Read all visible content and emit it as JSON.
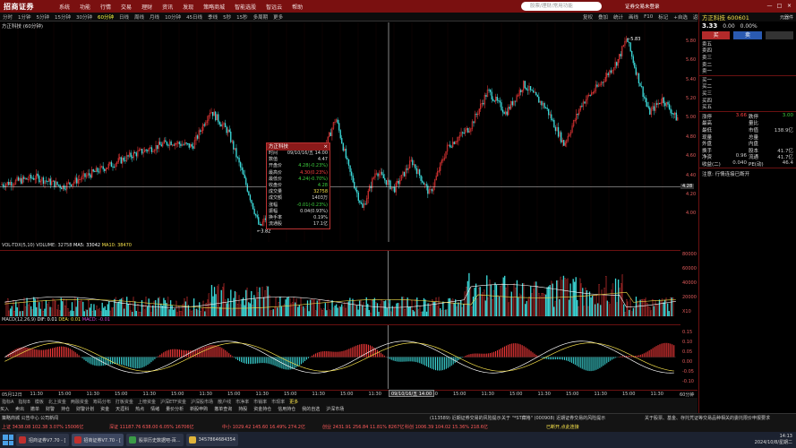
{
  "top": {
    "logo": "招商证券",
    "menu": [
      "系统",
      "功能",
      "行情",
      "交易",
      "理财",
      "资讯",
      "发现",
      "策略商城",
      "智能选股",
      "智远云",
      "帮助"
    ],
    "search_placeholder": "股票/理财/常用功能",
    "login_label": "证券交易未登录",
    "win_min": "—",
    "win_max": "□",
    "win_close": "×"
  },
  "periods": [
    "分时",
    "1分钟",
    "5分钟",
    "15分钟",
    "30分钟",
    "60分钟",
    "日线",
    "周线",
    "月线",
    "10分钟",
    "45日线",
    "季线",
    "5秒",
    "15秒",
    "多周期",
    "更多"
  ],
  "active_period": "60分钟",
  "right_tools": [
    "复权",
    "叠加",
    "统计",
    "画线",
    "F10",
    "标记",
    "+自选",
    "返回"
  ],
  "chart_title": "方正科技 (60分钟)",
  "price_axis": [
    "5.80",
    "5.60",
    "5.40",
    "5.20",
    "5.00",
    "4.80",
    "4.60",
    "4.40",
    "4.20",
    "4.00"
  ],
  "price_levels": [
    5.8,
    5.6,
    5.4,
    5.2,
    5.0,
    4.8,
    4.6,
    4.4,
    4.2,
    4.0
  ],
  "crosshair_price": "4.28",
  "price_high_label": "5.83",
  "price_low_label": "3.82",
  "vol_title": {
    "name": "VOL-TDX(5,10)",
    "volume": "VOLUME: 32758",
    "ma5": "MA5: 33042",
    "ma10": "MA10: 38470",
    "ma5_color": "#ffffff",
    "ma10_color": "#f5e04a"
  },
  "vol_axis": [
    "80000",
    "60000",
    "40000",
    "20000",
    "X10"
  ],
  "macd_title": {
    "name": "MACD(12,26,9)",
    "dif": "DIF: 0.01",
    "dea": "DEA: 0.01",
    "macd": "MACD: -0.01"
  },
  "macd_axis": [
    "0.15",
    "0.10",
    "0.05",
    "0.00",
    "-0.05",
    "-0.10"
  ],
  "x_axis": [
    "05月12日",
    "11:30",
    "15:00",
    "11:30",
    "15:00",
    "11:30",
    "15:00",
    "11:30",
    "15:00",
    "11:30",
    "15:00",
    "11:30",
    "15:00",
    "11:30",
    "15:00",
    "11:30",
    "15:00",
    "11:30",
    "15:00",
    "11:30",
    "15:00",
    "11:30",
    "15:00",
    "11:30",
    "60分钟"
  ],
  "crosshair_time": "09/10/16/五 14:00",
  "tabs": [
    "指标A",
    "指标B",
    "模板",
    "北上资金",
    "两融资金",
    "筹码分布",
    "打板资金",
    "上榜资金",
    "沪深ETF资金",
    "沪深股市场",
    "散户线",
    "市净率",
    "市销率",
    "市现率",
    "更多"
  ],
  "toolbar2": [
    "买入",
    "卖出",
    "撤单",
    "财警",
    "持仓",
    "财警计划",
    "资金",
    "天涯科",
    "热点",
    "情绪",
    "量价分析",
    "新股申购",
    "撤单查询",
    "持股",
    "资金持仓",
    "信用持仓",
    "我的自选",
    "沪深市场"
  ],
  "tooltip": {
    "title": "方正科技",
    "rows": [
      {
        "k": "时间",
        "v": "09/10/16/五 14:00",
        "color": "#dddddd"
      },
      {
        "k": "数值",
        "v": "4.47",
        "color": "#dddddd"
      },
      {
        "k": "开盘价",
        "v": "4.28(-0.23%)",
        "color": "#3ecf3e"
      },
      {
        "k": "最高价",
        "v": "4.30(0.23%)",
        "color": "#ff4040"
      },
      {
        "k": "最低价",
        "v": "4.24(-0.70%)",
        "color": "#3ecf3e"
      },
      {
        "k": "收盘价",
        "v": "4.28",
        "color": "#3ecf3e"
      },
      {
        "k": "成交量",
        "v": "32758",
        "color": "#f5e04a"
      },
      {
        "k": "成交额",
        "v": "1403万",
        "color": "#dddddd"
      },
      {
        "k": "涨幅",
        "v": "-0.01(-0.23%)",
        "color": "#3ecf3e"
      },
      {
        "k": "振幅",
        "v": "0.04(0.93%)",
        "color": "#dddddd"
      },
      {
        "k": "换手率",
        "v": "0.19%",
        "color": "#dddddd"
      },
      {
        "k": "流通股",
        "v": "17.1亿",
        "color": "#dddddd"
      }
    ]
  },
  "stock": {
    "name_code": "方正科技 600601",
    "board": "元器件",
    "price": "3.33",
    "change": "0.00",
    "pct": "0.00%",
    "buy_btn": "买",
    "sell_btn": "卖",
    "asks": [
      "卖五",
      "卖四",
      "卖三",
      "卖二",
      "卖一"
    ],
    "bids": [
      "买一",
      "买二",
      "买三",
      "买四",
      "买五"
    ],
    "stats": [
      {
        "a": "涨停",
        "av": "3.66",
        "b": "跌停",
        "bv": "3.00",
        "ac": "#ff4040",
        "bc": "#3ecf3e"
      },
      {
        "a": "最高",
        "av": "",
        "b": "量比",
        "bv": "",
        "ac": "#ccc",
        "bc": "#ccc"
      },
      {
        "a": "最低",
        "av": "",
        "b": "市值",
        "bv": "138.9亿",
        "ac": "#ccc",
        "bc": "#ccc"
      },
      {
        "a": "现量",
        "av": "",
        "b": "总量",
        "bv": "",
        "ac": "#ccc",
        "bc": "#ccc"
      },
      {
        "a": "外盘",
        "av": "",
        "b": "内盘",
        "bv": "",
        "ac": "#ccc",
        "bc": "#ccc"
      },
      {
        "a": "换手",
        "av": "",
        "b": "股本",
        "bv": "41.7亿",
        "ac": "#ccc",
        "bc": "#ccc"
      },
      {
        "a": "净资",
        "av": "0.96",
        "b": "流通",
        "bv": "41.7亿",
        "ac": "#ccc",
        "bc": "#ccc"
      },
      {
        "a": "收益(二)",
        "av": "0.040",
        "b": "PE(动)",
        "bv": "46.4",
        "ac": "#ccc",
        "bc": "#ccc"
      }
    ],
    "note": "注意: 行情连接已断开"
  },
  "ticker": [
    {
      "label": "上证",
      "value": "3438.08",
      "change": "102.38",
      "pct": "3.07%",
      "amount": "15006亿",
      "color": "#ff4040"
    },
    {
      "label": "深证",
      "value": "11187.76",
      "change": "638.00",
      "pct": "6.05%",
      "amount": "16706亿",
      "color": "#ff4040"
    },
    {
      "label": "中小",
      "value": "",
      "change": "",
      "pct": "",
      "amount": "",
      "color": "#ff4040"
    },
    {
      "label": "创业",
      "value": "",
      "change": "",
      "pct": "",
      "amount": "",
      "color": "#ff4040"
    }
  ],
  "ticker_text": {
    "t1": "上证 3438.08  102.38  3.07%  15006亿",
    "t2": "深证 11187.76 638.00  6.05%  16706亿",
    "t3": "中小 1029.42  145.60  16.49%  274.2亿",
    "t4": "创业 2431.91  256.84  11.81%  8267亿",
    "t5": "科创 1006.39  104.02  15.36%  218.6亿",
    "msg1": "(113589) 近期证券交易的风险提示",
    "msg2": "关于 \"*ST藏格\" (000908) 近期证券交易的风险提示",
    "msg3": "关于股票、基金、存托凭证等交易品种相关的委托限价申报要求",
    "bottom_left": "策略商城  公告中心  公司新闻",
    "status": "已断开,点此连接",
    "clock_time": "14:13",
    "clock_date": "2024/10/8/星期二"
  },
  "taskbar": [
    {
      "label": "招商证券V7.70 - [",
      "color": "#c0302e"
    },
    {
      "label": "招商证券V7.70 - [",
      "color": "#c0302e"
    },
    {
      "label": "股票历史数据吧-百...",
      "color": "#3b9b46"
    },
    {
      "label": "3457864684354",
      "color": "#e0b43a"
    }
  ]
}
